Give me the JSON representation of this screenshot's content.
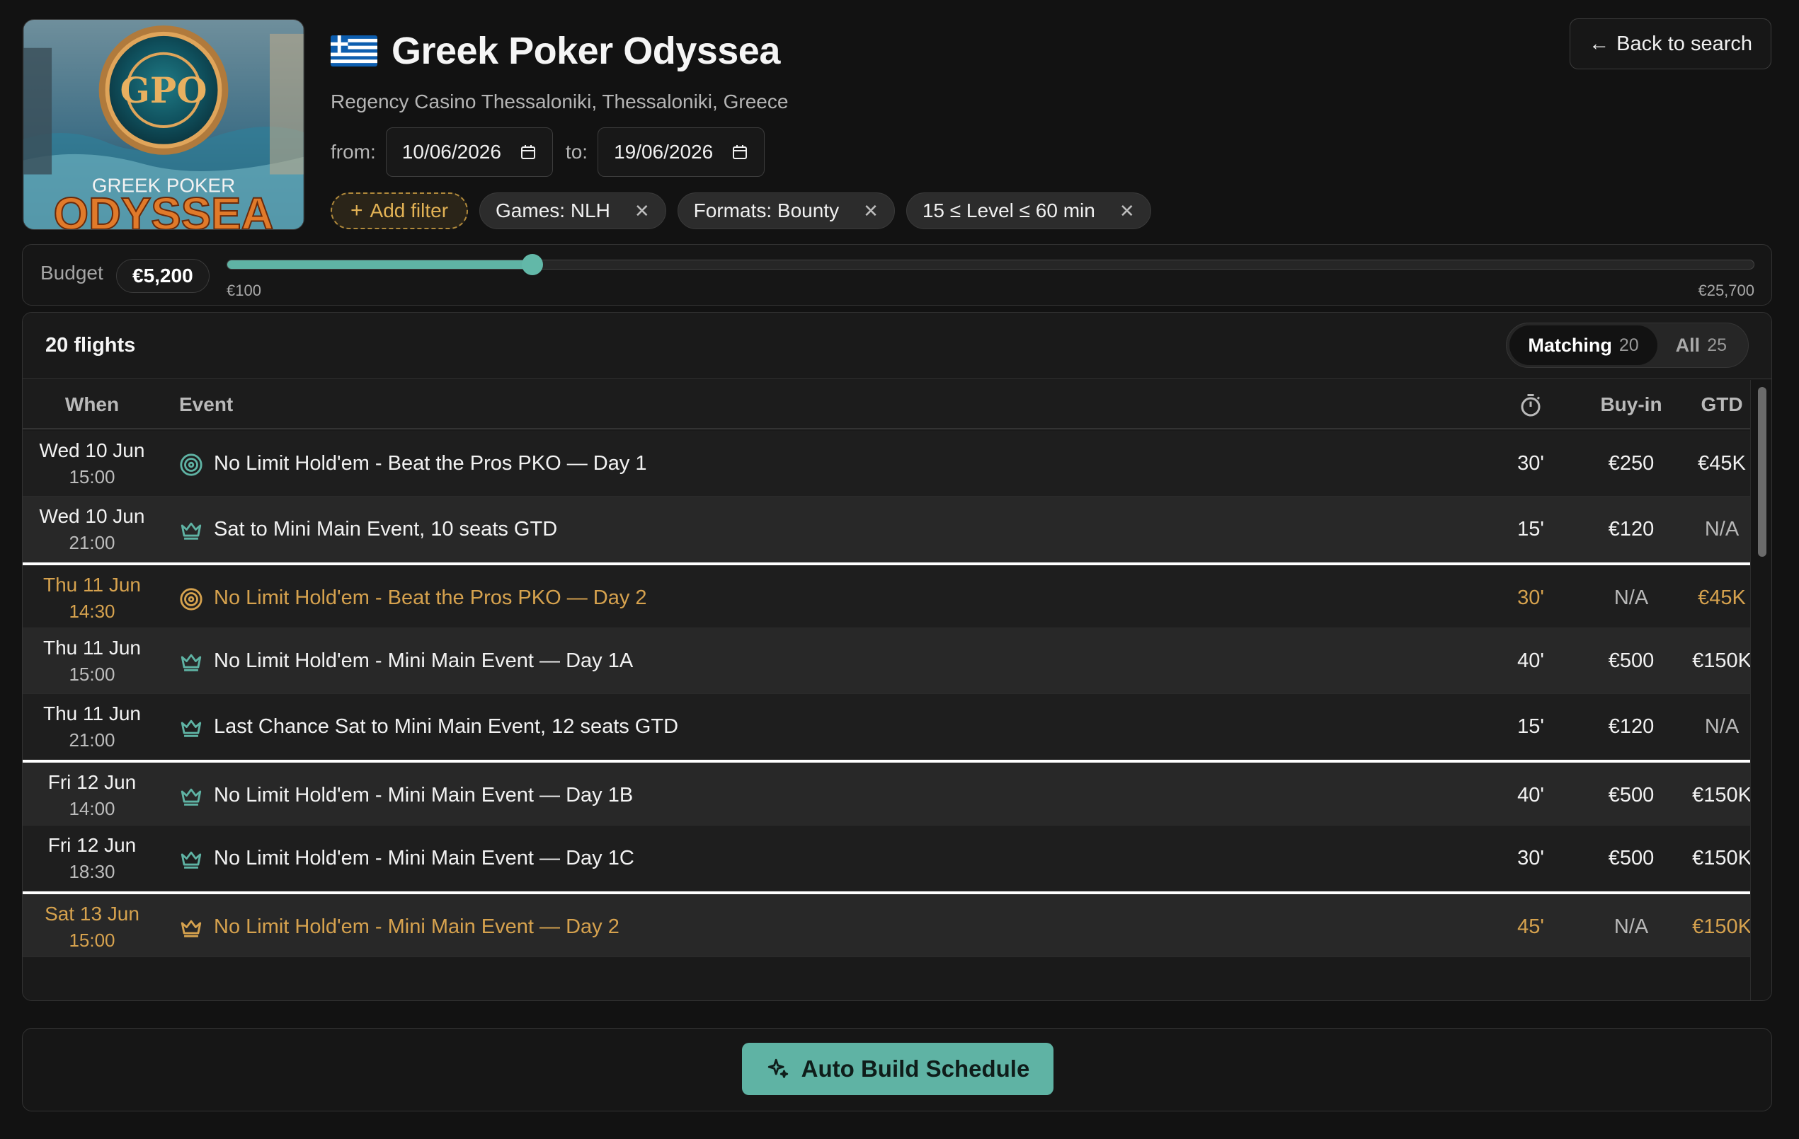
{
  "event": {
    "title": "Greek Poker Odyssea",
    "venue": "Regency Casino Thessaloniki, Thessaloniki, Greece",
    "logo_text_top": "GREEK POKER",
    "logo_text_bottom": "ODYSSEA",
    "logo_monogram": "GPO"
  },
  "header": {
    "back_label": "Back to search",
    "back_icon": "arrow-left-icon"
  },
  "dates": {
    "from_label": "from:",
    "from_value": "10/06/2026",
    "to_label": "to:",
    "to_value": "19/06/2026"
  },
  "filters": {
    "add_label": "Add filter",
    "chips": [
      {
        "label": "Games: NLH"
      },
      {
        "label": "Formats: Bounty"
      },
      {
        "label": "15 ≤ Level ≤ 60 min"
      }
    ]
  },
  "budget": {
    "label": "Budget",
    "value": "€5,200",
    "min_label": "€100",
    "max_label": "€25,700",
    "slider_fraction": 0.2
  },
  "table": {
    "count_label": "20 flights",
    "toggle": [
      {
        "label": "Matching",
        "count": "20",
        "active": true
      },
      {
        "label": "All",
        "count": "25",
        "active": false
      }
    ],
    "headers": {
      "when": "When",
      "event": "Event",
      "level_icon": "stopwatch-icon",
      "buyin": "Buy-in",
      "gtd": "GTD"
    },
    "rows": [
      {
        "date": "Wed 10 Jun",
        "time": "15:00",
        "icon": "target-icon",
        "event": "No Limit Hold'em - Beat the Pros PKO — Day 1",
        "level": "30'",
        "buyin": "€250",
        "gtd": "€45K",
        "highlight": false,
        "day_start": false
      },
      {
        "date": "Wed 10 Jun",
        "time": "21:00",
        "icon": "crown-icon",
        "event": "Sat to Mini Main Event, 10 seats GTD",
        "level": "15'",
        "buyin": "€120",
        "gtd": "N/A",
        "highlight": false,
        "day_start": false
      },
      {
        "date": "Thu 11 Jun",
        "time": "14:30",
        "icon": "target-icon",
        "event": "No Limit Hold'em - Beat the Pros PKO — Day 2",
        "level": "30'",
        "buyin": "N/A",
        "gtd": "€45K",
        "highlight": true,
        "day_start": true
      },
      {
        "date": "Thu 11 Jun",
        "time": "15:00",
        "icon": "crown-icon",
        "event": "No Limit Hold'em - Mini Main Event — Day 1A",
        "level": "40'",
        "buyin": "€500",
        "gtd": "€150K",
        "highlight": false,
        "day_start": false
      },
      {
        "date": "Thu 11 Jun",
        "time": "21:00",
        "icon": "crown-icon",
        "event": "Last Chance Sat to Mini Main Event, 12 seats GTD",
        "level": "15'",
        "buyin": "€120",
        "gtd": "N/A",
        "highlight": false,
        "day_start": false
      },
      {
        "date": "Fri 12 Jun",
        "time": "14:00",
        "icon": "crown-icon",
        "event": "No Limit Hold'em - Mini Main Event — Day 1B",
        "level": "40'",
        "buyin": "€500",
        "gtd": "€150K",
        "highlight": false,
        "day_start": true
      },
      {
        "date": "Fri 12 Jun",
        "time": "18:30",
        "icon": "crown-icon",
        "event": "No Limit Hold'em - Mini Main Event — Day 1C",
        "level": "30'",
        "buyin": "€500",
        "gtd": "€150K",
        "highlight": false,
        "day_start": false
      },
      {
        "date": "Sat 13 Jun",
        "time": "15:00",
        "icon": "crown-icon",
        "event": "No Limit Hold'em - Mini Main Event — Day 2",
        "level": "45'",
        "buyin": "N/A",
        "gtd": "€150K",
        "highlight": true,
        "day_start": true
      }
    ]
  },
  "footer": {
    "auto_build_label": "Auto Build Schedule",
    "auto_build_icon": "sparkle-icon"
  },
  "colors": {
    "accent": "#5fb3a4",
    "highlight": "#d6a24e",
    "background": "#121212"
  }
}
